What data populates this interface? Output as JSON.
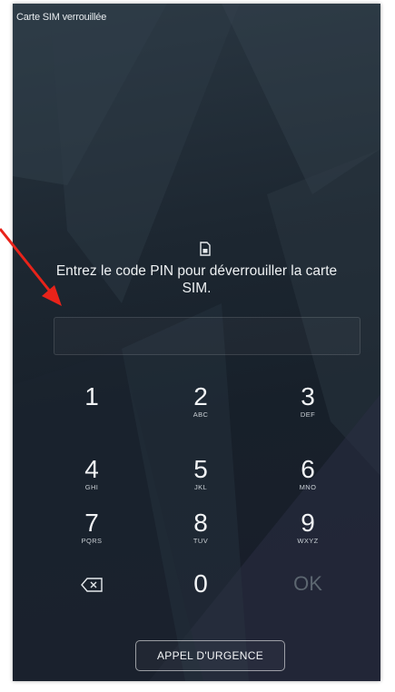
{
  "status_bar": {
    "text": "Carte SIM verrouillée"
  },
  "prompt": {
    "line1": "Entrez le code PIN pour déverrouiller la carte",
    "line2": "SIM."
  },
  "pin_field": {
    "value": ""
  },
  "keypad": {
    "keys": [
      {
        "digit": "1",
        "letters": ""
      },
      {
        "digit": "2",
        "letters": "ABC"
      },
      {
        "digit": "3",
        "letters": "DEF"
      },
      {
        "digit": "4",
        "letters": "GHI"
      },
      {
        "digit": "5",
        "letters": "JKL"
      },
      {
        "digit": "6",
        "letters": "MNO"
      },
      {
        "digit": "7",
        "letters": "PQRS"
      },
      {
        "digit": "8",
        "letters": "TUV"
      },
      {
        "digit": "9",
        "letters": "WXYZ"
      }
    ],
    "zero": "0",
    "ok": "OK"
  },
  "emergency_button": {
    "label": "APPEL D'URGENCE"
  },
  "icons": {
    "sim": "sim-card-icon",
    "backspace": "backspace-icon",
    "annotation": "red-arrow-annotation"
  },
  "colors": {
    "background": "#1d2731",
    "text": "#eef1f3",
    "ok_disabled": "#5c6670",
    "annotation": "#e8231a"
  }
}
